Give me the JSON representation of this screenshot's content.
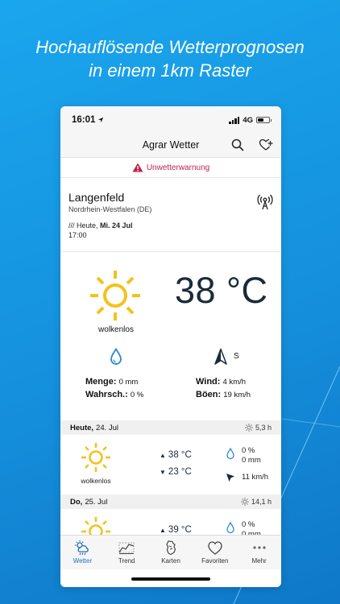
{
  "headline": {
    "line1": "Hochauflösende Wetterprognosen",
    "line2": "in einem 1km Raster"
  },
  "status_bar": {
    "time": "16:01",
    "network": "4G",
    "battery_level": 0.5
  },
  "nav": {
    "title": "Agrar Wetter",
    "search_icon": "search-icon",
    "favorite_add_icon": "heart-plus-icon"
  },
  "warning": {
    "label": "Unwetterwarnung",
    "color": "#c4204a"
  },
  "location": {
    "name": "Langenfeld",
    "region": "Nordrhein-Westfalen (DE)",
    "date_prefix": "/// Heute, ",
    "date_bold": "Mi. 24 Jul",
    "time": "17:00"
  },
  "current": {
    "condition": "wolkenlos",
    "temperature": "38 °C",
    "wind_direction": "S",
    "precip_amount_label": "Menge:",
    "precip_amount_value": "0 mm",
    "precip_prob_label": "Wahrsch.:",
    "precip_prob_value": "0 %",
    "wind_label": "Wind:",
    "wind_value": "4 km/h",
    "gusts_label": "Böen:",
    "gusts_value": "19 km/h"
  },
  "days": [
    {
      "day_bold": "Heute,",
      "date": "24. Jul",
      "sun_hours": "5,3 h",
      "condition": "wolkenlos",
      "tmax": "38 °C",
      "tmin": "23 °C",
      "precip_prob": "0 %",
      "precip_amount": "0 mm",
      "wind": "11 km/h"
    },
    {
      "day_bold": "Do,",
      "date": "25. Jul",
      "sun_hours": "14,1 h",
      "tmax": "39 °C",
      "precip_prob": "0 %",
      "precip_amount": "0 mm"
    }
  ],
  "tabs": [
    {
      "label": "Wetter",
      "icon": "weather-icon",
      "active": true
    },
    {
      "label": "Trend",
      "icon": "trend-icon",
      "active": false
    },
    {
      "label": "Karten",
      "icon": "map-icon",
      "active": false
    },
    {
      "label": "Favoriten",
      "icon": "heart-icon",
      "active": false
    },
    {
      "label": "Mehr",
      "icon": "more-icon",
      "active": false
    }
  ],
  "colors": {
    "accent": "#1f6fc0",
    "sun": "#f4c21b",
    "background": "#1590dc"
  }
}
